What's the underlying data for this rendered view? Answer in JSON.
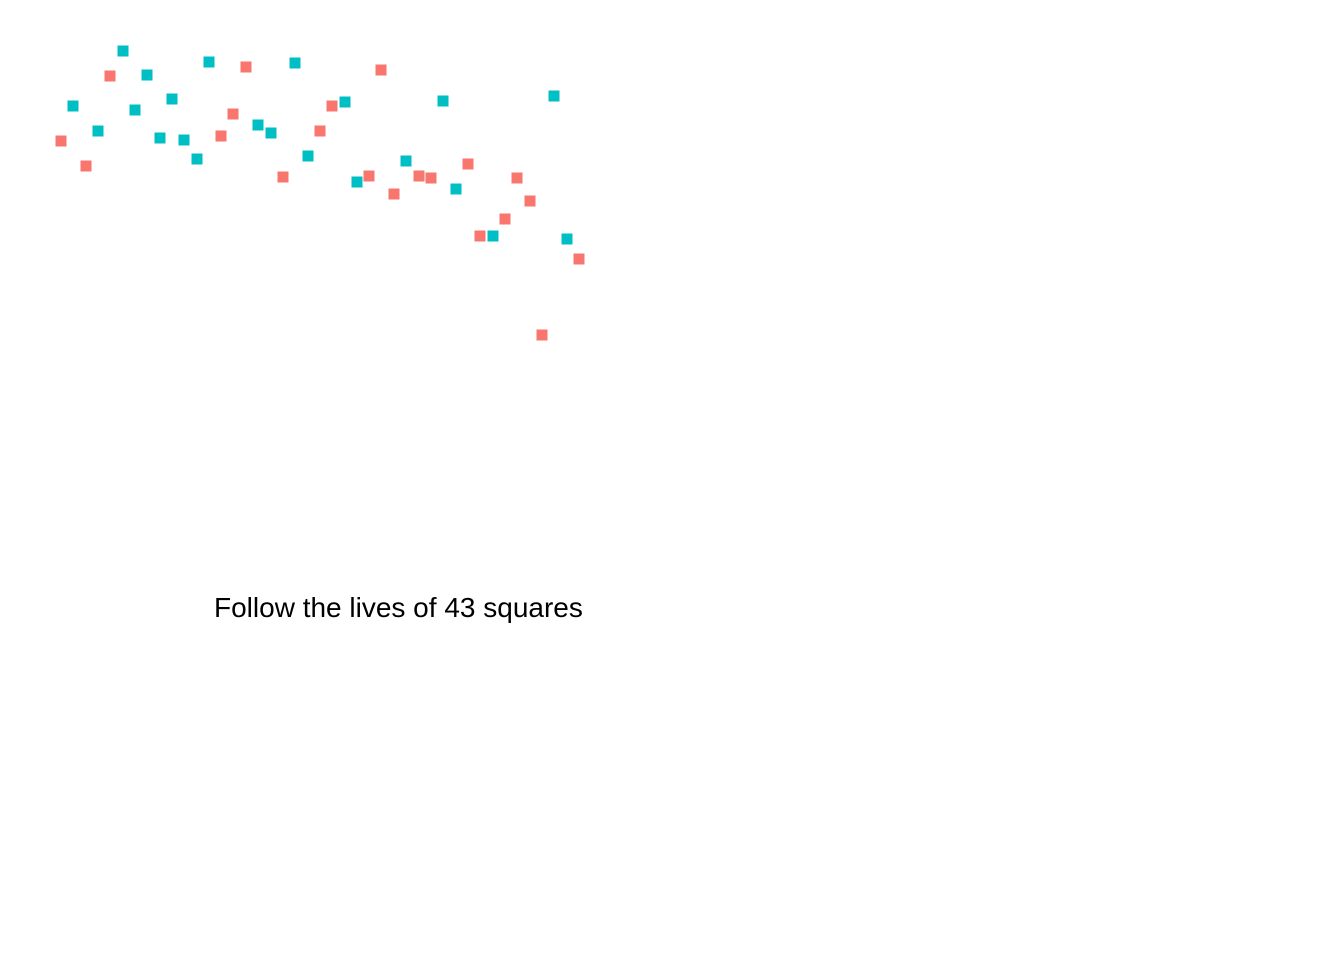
{
  "chart_data": {
    "type": "scatter",
    "title": "Follow the lives of 43 squares",
    "xlabel": "",
    "ylabel": "",
    "grid": false,
    "legend": "none",
    "marker": "square",
    "series": [
      {
        "color": "#F8766D",
        "points": [
          [
            61,
            141
          ],
          [
            86,
            166
          ],
          [
            110,
            76
          ],
          [
            221,
            136
          ],
          [
            233,
            114
          ],
          [
            246,
            67
          ],
          [
            283,
            177
          ],
          [
            320,
            131
          ],
          [
            332,
            106
          ],
          [
            369,
            176
          ],
          [
            381,
            70
          ],
          [
            394,
            194
          ],
          [
            419,
            176
          ],
          [
            431,
            178
          ],
          [
            468,
            164
          ],
          [
            480,
            236
          ],
          [
            505,
            219
          ],
          [
            517,
            178
          ],
          [
            530,
            201
          ],
          [
            542,
            335
          ],
          [
            579,
            259
          ]
        ]
      },
      {
        "color": "#00BFC4",
        "points": [
          [
            73,
            106
          ],
          [
            98,
            131
          ],
          [
            123,
            51
          ],
          [
            135,
            110
          ],
          [
            147,
            75
          ],
          [
            160,
            138
          ],
          [
            172,
            99
          ],
          [
            184,
            140
          ],
          [
            197,
            159
          ],
          [
            209,
            62
          ],
          [
            258,
            125
          ],
          [
            271,
            133
          ],
          [
            295,
            63
          ],
          [
            308,
            156
          ],
          [
            345,
            102
          ],
          [
            357,
            182
          ],
          [
            406,
            161
          ],
          [
            443,
            101
          ],
          [
            456,
            189
          ],
          [
            493,
            236
          ],
          [
            554,
            96
          ],
          [
            567,
            239
          ]
        ]
      }
    ]
  }
}
